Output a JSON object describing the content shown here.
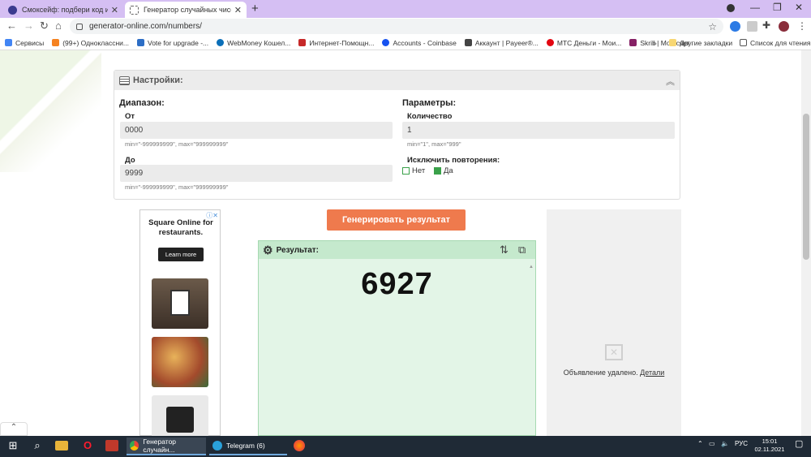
{
  "browser": {
    "tabs": [
      {
        "title": "Смоксейф: подбери код и получ",
        "active": false
      },
      {
        "title": "Генератор случайных чисел он",
        "active": true
      }
    ],
    "url": "generator-online.com/numbers/",
    "bookmarks": [
      {
        "label": "Сервисы",
        "color": "#4285f4"
      },
      {
        "label": "(99+) Одноклассни...",
        "color": "#f58220"
      },
      {
        "label": "Vote for upgrade -...",
        "color": "#2d6ec5"
      },
      {
        "label": "WebMoney Кошел...",
        "color": "#0b6fb8"
      },
      {
        "label": "Интернет-Помощн...",
        "color": "#c62828"
      },
      {
        "label": "Accounts - Coinbase",
        "color": "#1652f0"
      },
      {
        "label": "Аккаунт | Payeer®...",
        "color": "#444444"
      },
      {
        "label": "МТС Деньги - Мои...",
        "color": "#e30611"
      },
      {
        "label": "Skrill | Мой счет",
        "color": "#862165"
      }
    ],
    "bookmarks_more": "»",
    "other_bookmarks": "Другие закладки",
    "reading_list": "Список для чтения"
  },
  "settings": {
    "title": "Настройки:",
    "range": {
      "heading": "Диапазон:",
      "from_label": "От",
      "from_value": "0000",
      "from_hint": "min=\"-999999999\", max=\"999999999\"",
      "to_label": "До",
      "to_value": "9999",
      "to_hint": "min=\"-999999999\", max=\"999999999\""
    },
    "params": {
      "heading": "Параметры:",
      "count_label": "Количество",
      "count_value": "1",
      "count_hint": "min=\"1\", max=\"999\"",
      "exclude_label": "Исключить повторения:",
      "options": [
        "Нет",
        "Да"
      ],
      "selected": "Да"
    }
  },
  "generate_button": "Генерировать результат",
  "result": {
    "title": "Результат:",
    "value": "6927"
  },
  "ad_left": {
    "title": "Square Online for restaurants.",
    "button": "Learn more"
  },
  "ad_right": {
    "removed_text": "Объявление удалено.",
    "details_link": "Детали"
  },
  "taskbar": {
    "apps": [
      "Генератор случайн...",
      "Telegram (6)"
    ],
    "lang": "РУС",
    "time": "15:01",
    "date": "02.11.2021"
  },
  "colors": {
    "tabstrip": "#d5bff3",
    "generate_button": "#ef7a4d",
    "result_bg": "#e3f5e7",
    "result_header": "#c5e9cd",
    "checkbox_green": "#3aa14a"
  }
}
